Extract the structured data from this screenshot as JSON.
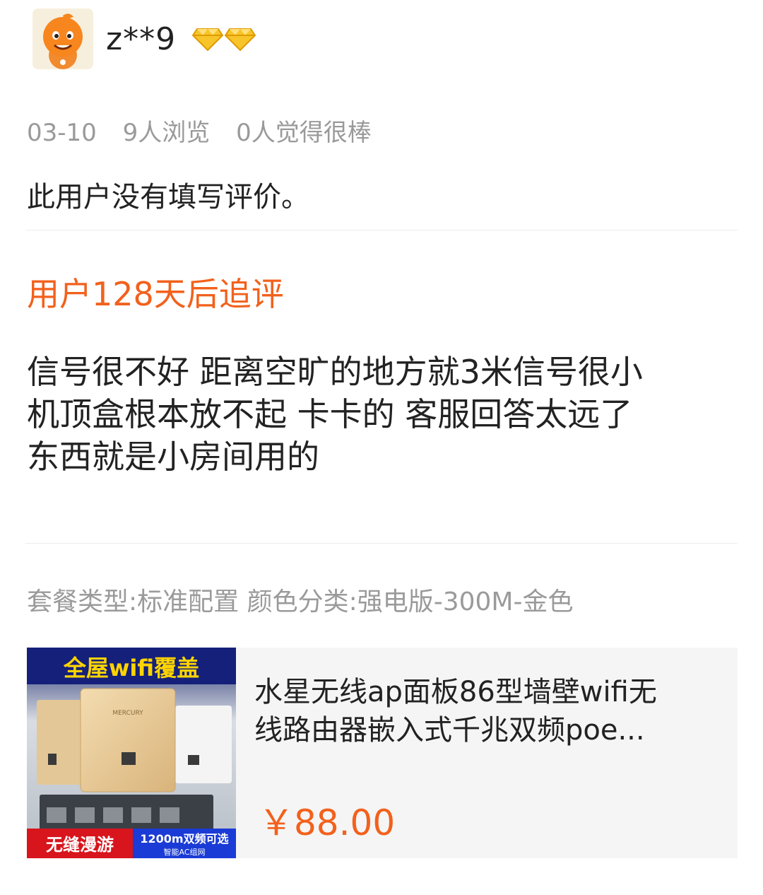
{
  "user": {
    "name": "z**9",
    "avatar": "orange-mascot-avatar",
    "badges": [
      "diamond-badge-icon",
      "diamond-badge-icon"
    ]
  },
  "meta": {
    "date": "03-10",
    "views": "9人浏览",
    "likes": "0人觉得很棒"
  },
  "review": {
    "text": "此用户没有填写评价。"
  },
  "followup": {
    "title": "用户128天后追评",
    "lines": [
      "信号很不好 距离空旷的地方就3米信号很小",
      "机顶盒根本放不起  卡卡的 客服回答太远了",
      "东西就是小房间用的"
    ]
  },
  "sku": "套餐类型:标准配置 颜色分类:强电版-300M-金色",
  "product": {
    "title_lines": [
      "水星无线ap面板86型墙壁wifi无",
      "线路由器嵌入式千兆双频poe..."
    ],
    "price": "￥88.00",
    "thumb": {
      "banner": "全屋wifi覆盖",
      "brand": "MERCURY",
      "tag_left": "无缝漫游",
      "tag_right_top": "1200m双频可选",
      "tag_right_bottom": "智能AC组网"
    }
  },
  "colors": {
    "accent": "#f2611c",
    "muted": "#9a9a9a",
    "gold": "#f5b400"
  }
}
